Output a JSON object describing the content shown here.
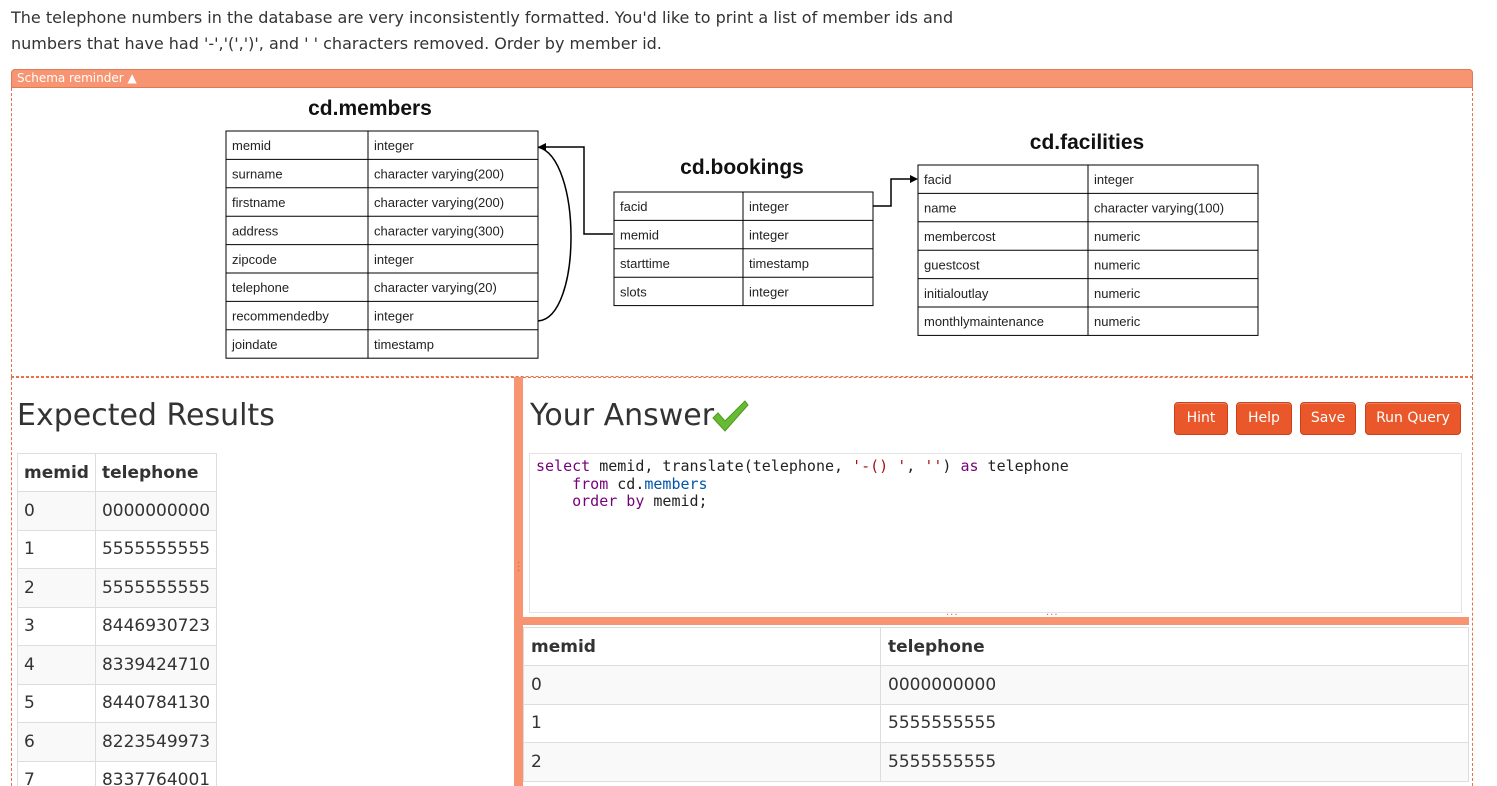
{
  "question": "The telephone numbers in the database are very inconsistently formatted. You'd like to print a list of member ids and numbers that have had '-','(',')', and ' ' characters removed. Order by member id.",
  "schema_toggle": "Schema reminder ▲",
  "schema": {
    "members": {
      "title": "cd.members",
      "rows": [
        [
          "memid",
          "integer"
        ],
        [
          "surname",
          "character varying(200)"
        ],
        [
          "firstname",
          "character varying(200)"
        ],
        [
          "address",
          "character varying(300)"
        ],
        [
          "zipcode",
          "integer"
        ],
        [
          "telephone",
          "character varying(20)"
        ],
        [
          "recommendedby",
          "integer"
        ],
        [
          "joindate",
          "timestamp"
        ]
      ]
    },
    "bookings": {
      "title": "cd.bookings",
      "rows": [
        [
          "facid",
          "integer"
        ],
        [
          "memid",
          "integer"
        ],
        [
          "starttime",
          "timestamp"
        ],
        [
          "slots",
          "integer"
        ]
      ]
    },
    "facilities": {
      "title": "cd.facilities",
      "rows": [
        [
          "facid",
          "integer"
        ],
        [
          "name",
          "character varying(100)"
        ],
        [
          "membercost",
          "numeric"
        ],
        [
          "guestcost",
          "numeric"
        ],
        [
          "initialoutlay",
          "numeric"
        ],
        [
          "monthlymaintenance",
          "numeric"
        ]
      ]
    }
  },
  "expected": {
    "heading": "Expected Results",
    "columns": [
      "memid",
      "telephone"
    ],
    "rows": [
      [
        "0",
        "0000000000"
      ],
      [
        "1",
        "5555555555"
      ],
      [
        "2",
        "5555555555"
      ],
      [
        "3",
        "8446930723"
      ],
      [
        "4",
        "8339424710"
      ],
      [
        "5",
        "8440784130"
      ],
      [
        "6",
        "8223549973"
      ],
      [
        "7",
        "8337764001"
      ]
    ]
  },
  "answer": {
    "heading": "Your Answer",
    "status_icon": "checkmark-icon",
    "buttons": {
      "hint": "Hint",
      "help": "Help",
      "save": "Save",
      "run": "Run Query"
    },
    "query": "select memid, translate(telephone, '-() ', '') as telephone\n    from cd.members\n    order by memid;",
    "result_columns": [
      "memid",
      "telephone"
    ],
    "result_rows": [
      [
        "0",
        "0000000000"
      ],
      [
        "1",
        "5555555555"
      ],
      [
        "2",
        "5555555555"
      ]
    ]
  },
  "colors": {
    "accent": "#f79573",
    "button": "#e9572a",
    "check": "#66bb33"
  }
}
